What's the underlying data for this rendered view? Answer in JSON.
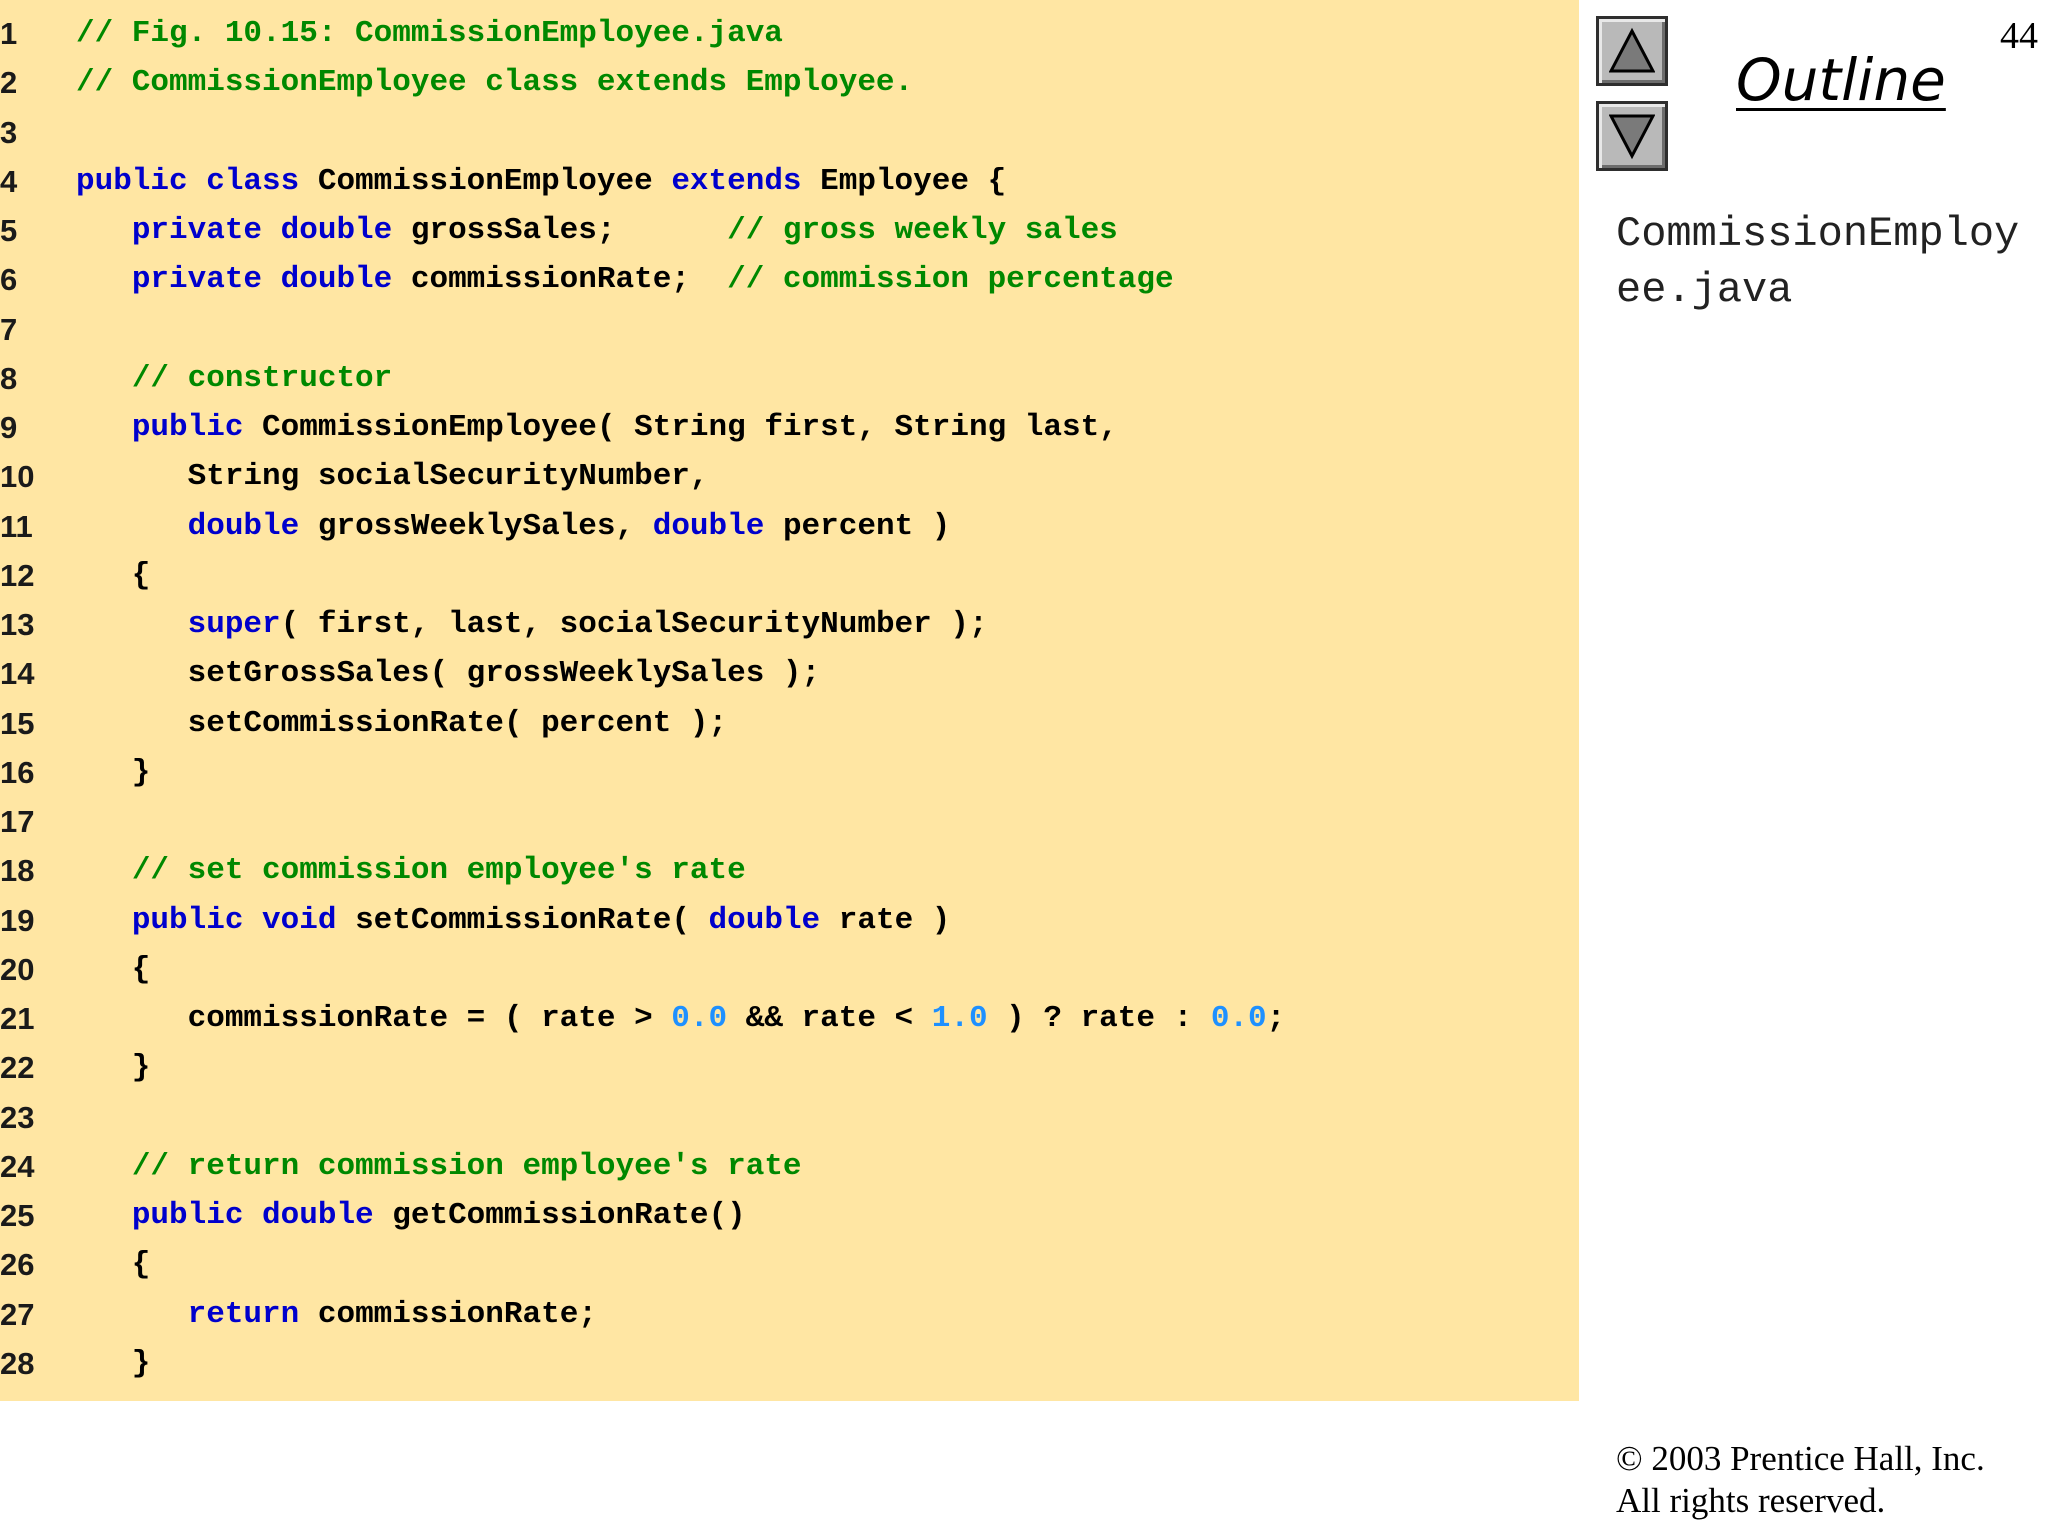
{
  "page_number": "44",
  "outline": {
    "title": "Outline",
    "file_label": "CommissionEmployee.java"
  },
  "nav": {
    "up_icon": "triangle-up-icon",
    "down_icon": "triangle-down-icon"
  },
  "copyright": {
    "line1": "© 2003 Prentice Hall, Inc.",
    "line2": "All rights reserved."
  },
  "colors": {
    "code_background": "#ffe6a3",
    "keyword": "#0000cc",
    "comment": "#008800",
    "number": "#1e90ff",
    "plain": "#000000"
  },
  "code_lines": [
    {
      "num": "1",
      "tokens": [
        [
          "cm",
          "// Fig. 10.15: CommissionEmployee.java"
        ]
      ]
    },
    {
      "num": "2",
      "tokens": [
        [
          "cm",
          "// CommissionEmployee class extends Employee."
        ]
      ]
    },
    {
      "num": "3",
      "tokens": []
    },
    {
      "num": "4",
      "tokens": [
        [
          "kw",
          "public class "
        ],
        [
          "pl",
          "CommissionEmployee "
        ],
        [
          "kw",
          "extends "
        ],
        [
          "pl",
          "Employee {"
        ]
      ]
    },
    {
      "num": "5",
      "tokens": [
        [
          "pl",
          "   "
        ],
        [
          "kw",
          "private double "
        ],
        [
          "pl",
          "grossSales;      "
        ],
        [
          "cm",
          "// gross weekly sales"
        ]
      ]
    },
    {
      "num": "6",
      "tokens": [
        [
          "pl",
          "   "
        ],
        [
          "kw",
          "private double "
        ],
        [
          "pl",
          "commissionRate;  "
        ],
        [
          "cm",
          "// commission percentage"
        ]
      ]
    },
    {
      "num": "7",
      "tokens": []
    },
    {
      "num": "8",
      "tokens": [
        [
          "pl",
          "   "
        ],
        [
          "cm",
          "// constructor"
        ]
      ]
    },
    {
      "num": "9",
      "tokens": [
        [
          "pl",
          "   "
        ],
        [
          "kw",
          "public "
        ],
        [
          "pl",
          "CommissionEmployee( String first, String last,"
        ]
      ]
    },
    {
      "num": "10",
      "tokens": [
        [
          "pl",
          "      String socialSecurityNumber,"
        ]
      ]
    },
    {
      "num": "11",
      "tokens": [
        [
          "pl",
          "      "
        ],
        [
          "kw",
          "double "
        ],
        [
          "pl",
          "grossWeeklySales, "
        ],
        [
          "kw",
          "double "
        ],
        [
          "pl",
          "percent )"
        ]
      ]
    },
    {
      "num": "12",
      "tokens": [
        [
          "pl",
          "   {"
        ]
      ]
    },
    {
      "num": "13",
      "tokens": [
        [
          "pl",
          "      "
        ],
        [
          "kw",
          "super"
        ],
        [
          "pl",
          "( first, last, socialSecurityNumber );"
        ]
      ]
    },
    {
      "num": "14",
      "tokens": [
        [
          "pl",
          "      setGrossSales( grossWeeklySales );"
        ]
      ]
    },
    {
      "num": "15",
      "tokens": [
        [
          "pl",
          "      setCommissionRate( percent );"
        ]
      ]
    },
    {
      "num": "16",
      "tokens": [
        [
          "pl",
          "   }"
        ]
      ]
    },
    {
      "num": "17",
      "tokens": []
    },
    {
      "num": "18",
      "tokens": [
        [
          "pl",
          "   "
        ],
        [
          "cm",
          "// set commission employee's rate"
        ]
      ]
    },
    {
      "num": "19",
      "tokens": [
        [
          "pl",
          "   "
        ],
        [
          "kw",
          "public void "
        ],
        [
          "pl",
          "setCommissionRate( "
        ],
        [
          "kw",
          "double "
        ],
        [
          "pl",
          "rate )"
        ]
      ]
    },
    {
      "num": "20",
      "tokens": [
        [
          "pl",
          "   {"
        ]
      ]
    },
    {
      "num": "21",
      "tokens": [
        [
          "pl",
          "      commissionRate = ( rate > "
        ],
        [
          "num",
          "0.0"
        ],
        [
          "pl",
          " && rate < "
        ],
        [
          "num",
          "1.0"
        ],
        [
          "pl",
          " ) ? rate : "
        ],
        [
          "num",
          "0.0"
        ],
        [
          "pl",
          ";"
        ]
      ]
    },
    {
      "num": "22",
      "tokens": [
        [
          "pl",
          "   }"
        ]
      ]
    },
    {
      "num": "23",
      "tokens": []
    },
    {
      "num": "24",
      "tokens": [
        [
          "pl",
          "   "
        ],
        [
          "cm",
          "// return commission employee's rate"
        ]
      ]
    },
    {
      "num": "25",
      "tokens": [
        [
          "pl",
          "   "
        ],
        [
          "kw",
          "public double "
        ],
        [
          "pl",
          "getCommissionRate()"
        ]
      ]
    },
    {
      "num": "26",
      "tokens": [
        [
          "pl",
          "   {"
        ]
      ]
    },
    {
      "num": "27",
      "tokens": [
        [
          "pl",
          "      "
        ],
        [
          "kw",
          "return "
        ],
        [
          "pl",
          "commissionRate;"
        ]
      ]
    },
    {
      "num": "28",
      "tokens": [
        [
          "pl",
          "   }"
        ]
      ]
    }
  ]
}
